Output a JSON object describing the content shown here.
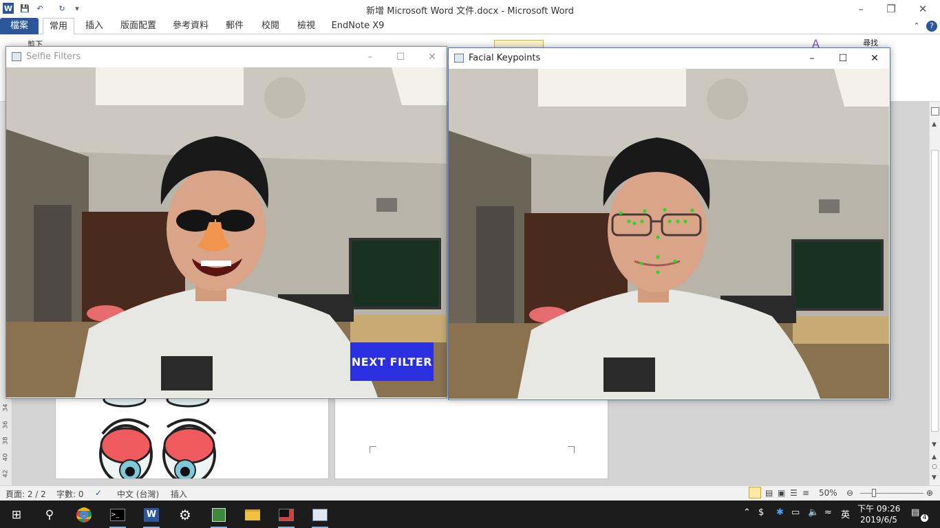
{
  "word": {
    "title": "新增 Microsoft Word 文件.docx - Microsoft Word",
    "tabs": [
      "檔案",
      "常用",
      "插入",
      "版面配置",
      "參考資料",
      "郵件",
      "校閱",
      "檢視",
      "EndNote X9"
    ],
    "active_tab": "常用",
    "ribbon_text": [
      "剪下",
      "尋找"
    ],
    "ruler_numbers": [
      "34",
      "36",
      "38",
      "40",
      "42"
    ],
    "status": {
      "page": "頁面: 2 / 2",
      "words": "字數: 0",
      "language": "中文 (台灣)",
      "mode": "插入",
      "zoom": "50%"
    }
  },
  "windows": {
    "selfie": {
      "title": "Selfie Filters",
      "button": "NEXT FILTER"
    },
    "keypoints": {
      "title": "Facial Keypoints"
    }
  },
  "taskbar": {
    "apps": [
      "Chrome",
      "Command Prompt",
      "Word",
      "Settings",
      "Charts",
      "File Explorer",
      "Python",
      "Image Viewer"
    ],
    "tray": {
      "ime": "英",
      "time": "下午 09:26",
      "date": "2019/6/5",
      "notifications": "4"
    }
  },
  "colors": {
    "word_accent": "#2b579a",
    "taskbar": "#1c1c1c",
    "button": "#2a2fe0",
    "keypoint": "#28d828"
  }
}
